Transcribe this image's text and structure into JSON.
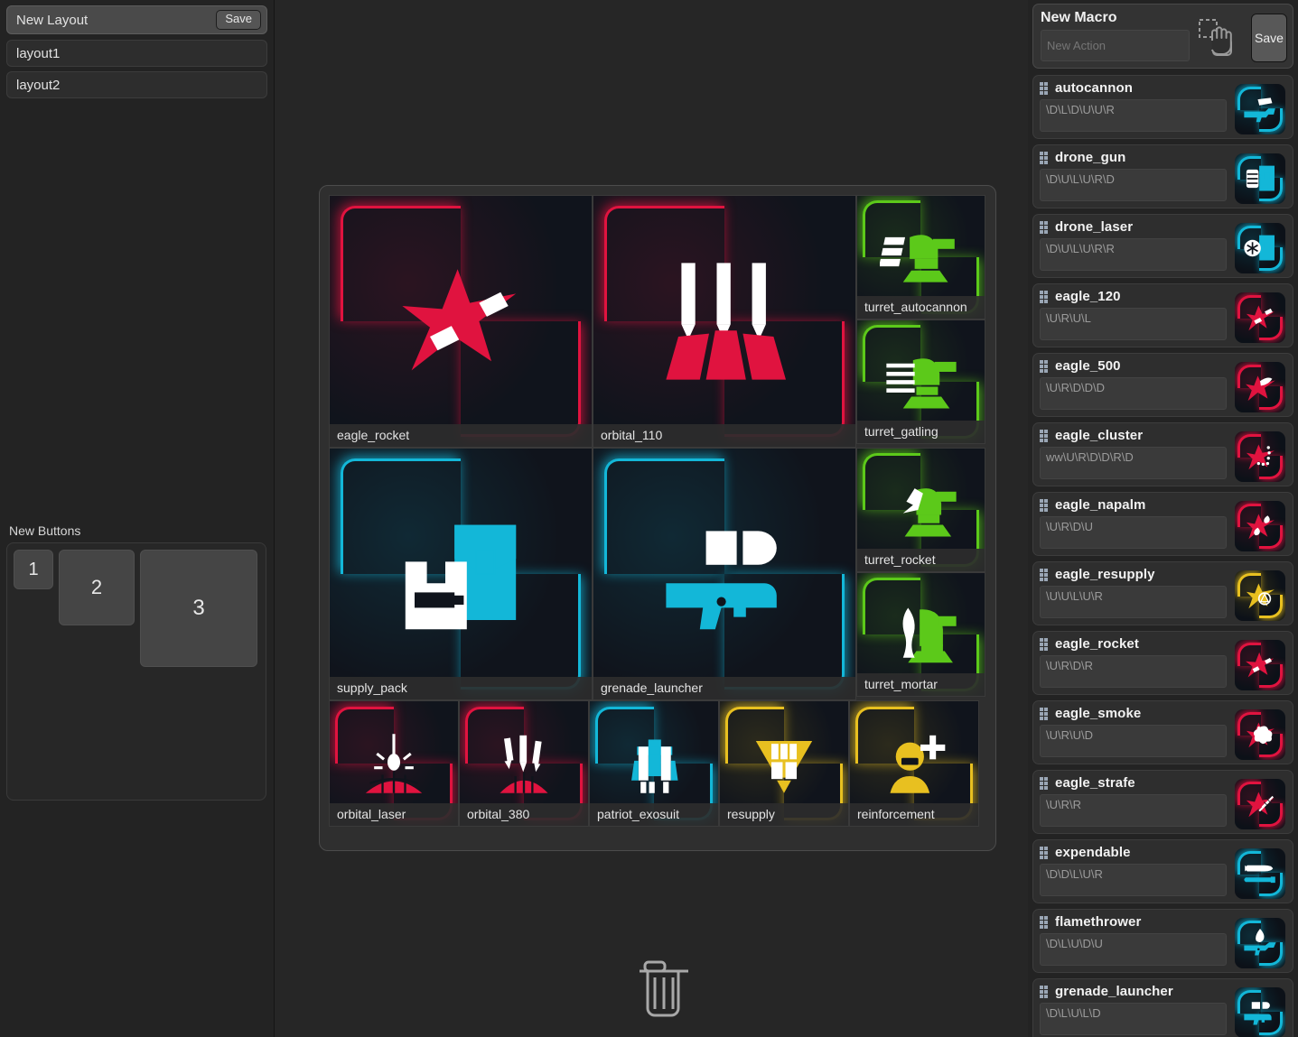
{
  "left_sidebar": {
    "new_layout": {
      "title": "New Layout",
      "save_label": "Save"
    },
    "layouts": [
      {
        "name": "layout1"
      },
      {
        "name": "layout2"
      }
    ],
    "new_buttons": {
      "label": "New Buttons",
      "items": [
        {
          "label": "1"
        },
        {
          "label": "2"
        },
        {
          "label": "3"
        }
      ]
    }
  },
  "center": {
    "trash_icon": "trash-icon",
    "grid": {
      "rows": [
        {
          "cells": [
            {
              "label": "eagle_rocket",
              "icon": "eagle-rocket-icon",
              "color": "#e0133f",
              "size": "large"
            },
            {
              "label": "orbital_110",
              "icon": "orbital-110-icon",
              "color": "#e0133f",
              "size": "large"
            },
            {
              "label": "turret_autocannon",
              "icon": "turret-autocannon-icon",
              "color": "#5cc91a",
              "size": "small"
            },
            {
              "label": "turret_gatling",
              "icon": "turret-gatling-icon",
              "color": "#5cc91a",
              "size": "small"
            }
          ]
        },
        {
          "cells": [
            {
              "label": "supply_pack",
              "icon": "supply-pack-icon",
              "color": "#13b7d8",
              "size": "large"
            },
            {
              "label": "grenade_launcher",
              "icon": "grenade-launcher-icon",
              "color": "#13b7d8",
              "size": "large"
            },
            {
              "label": "turret_rocket",
              "icon": "turret-rocket-icon",
              "color": "#5cc91a",
              "size": "small"
            },
            {
              "label": "turret_mortar",
              "icon": "turret-mortar-icon",
              "color": "#5cc91a",
              "size": "small"
            }
          ]
        },
        {
          "cells": [
            {
              "label": "orbital_laser",
              "icon": "orbital-laser-icon",
              "color": "#e0133f",
              "size": "mini"
            },
            {
              "label": "orbital_380",
              "icon": "orbital-380-icon",
              "color": "#e0133f",
              "size": "mini"
            },
            {
              "label": "patriot_exosuit",
              "icon": "patriot-exosuit-icon",
              "color": "#13b7d8",
              "size": "mini"
            },
            {
              "label": "resupply",
              "icon": "resupply-icon",
              "color": "#e8c020",
              "size": "mini"
            },
            {
              "label": "reinforcement",
              "icon": "reinforcement-icon",
              "color": "#e8c020",
              "size": "mini"
            }
          ]
        }
      ]
    }
  },
  "right_panel": {
    "new_macro": {
      "title": "New Macro",
      "action_placeholder": "New Action",
      "action_value": "",
      "save_label": "Save",
      "drop_icon": "drag-drop-hand-icon"
    },
    "macros": [
      {
        "name": "autocannon",
        "sequence": "\\D\\L\\D\\U\\U\\R",
        "icon": "autocannon-icon",
        "color": "#13b7d8"
      },
      {
        "name": "drone_gun",
        "sequence": "\\D\\U\\L\\U\\R\\D",
        "icon": "drone-gun-icon",
        "color": "#13b7d8"
      },
      {
        "name": "drone_laser",
        "sequence": "\\D\\U\\L\\U\\R\\R",
        "icon": "drone-laser-icon",
        "color": "#13b7d8"
      },
      {
        "name": "eagle_120",
        "sequence": "\\U\\R\\U\\L",
        "icon": "eagle-120-icon",
        "color": "#e0133f"
      },
      {
        "name": "eagle_500",
        "sequence": "\\U\\R\\D\\D\\D",
        "icon": "eagle-500-icon",
        "color": "#e0133f"
      },
      {
        "name": "eagle_cluster",
        "sequence": "ww\\U\\R\\D\\D\\R\\D",
        "icon": "eagle-cluster-icon",
        "color": "#e0133f"
      },
      {
        "name": "eagle_napalm",
        "sequence": "\\U\\R\\D\\U",
        "icon": "eagle-napalm-icon",
        "color": "#e0133f"
      },
      {
        "name": "eagle_resupply",
        "sequence": "\\U\\U\\L\\U\\R",
        "icon": "eagle-resupply-icon",
        "color": "#e8c020"
      },
      {
        "name": "eagle_rocket",
        "sequence": "\\U\\R\\D\\R",
        "icon": "eagle-rocket-icon",
        "color": "#e0133f"
      },
      {
        "name": "eagle_smoke",
        "sequence": "\\U\\R\\U\\D",
        "icon": "eagle-smoke-icon",
        "color": "#e0133f"
      },
      {
        "name": "eagle_strafe",
        "sequence": "\\U\\R\\R",
        "icon": "eagle-strafe-icon",
        "color": "#e0133f"
      },
      {
        "name": "expendable",
        "sequence": "\\D\\D\\L\\U\\R",
        "icon": "expendable-icon",
        "color": "#13b7d8"
      },
      {
        "name": "flamethrower",
        "sequence": "\\D\\L\\U\\D\\U",
        "icon": "flamethrower-icon",
        "color": "#13b7d8"
      },
      {
        "name": "grenade_launcher",
        "sequence": "\\D\\L\\U\\L\\D",
        "icon": "grenade-launcher-icon",
        "color": "#13b7d8"
      }
    ]
  }
}
